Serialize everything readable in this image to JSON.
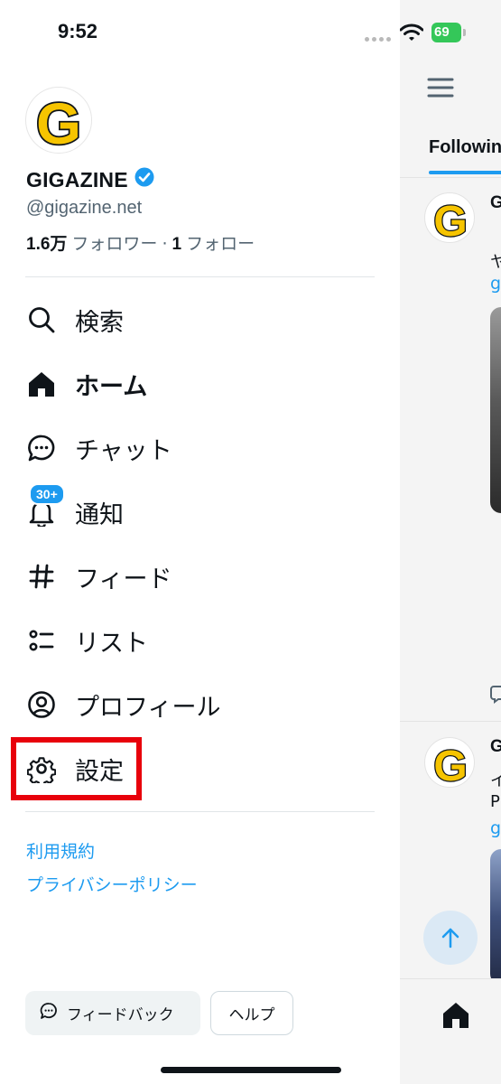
{
  "status_bar": {
    "time": "9:52",
    "battery": "69"
  },
  "profile": {
    "display_name": "GIGAZINE",
    "handle": "@gigazine.net",
    "followers_count": "1.6万",
    "followers_label": "フォロワー",
    "separator": "·",
    "following_count": "1",
    "following_label": "フォロー"
  },
  "menu": {
    "search": "検索",
    "home": "ホーム",
    "chat": "チャット",
    "notifications": "通知",
    "notifications_badge": "30+",
    "feeds": "フィード",
    "lists": "リスト",
    "profile": "プロフィール",
    "settings": "設定"
  },
  "footer": {
    "terms": "利用規約",
    "privacy": "プライバシーポリシー",
    "feedback": "フィードバック",
    "help": "ヘルプ"
  },
  "timeline": {
    "tab": "Following",
    "post1": {
      "name_fragment": "G",
      "text_fragment": "ヤ",
      "link_fragment": "g"
    },
    "post2": {
      "name_fragment": "G",
      "text_line1": "イ",
      "text_line2": "P",
      "link_fragment": "g"
    }
  },
  "colors": {
    "accent": "#1d9bf0",
    "highlight": "#e8000b",
    "logo_yellow": "#f6c400"
  }
}
